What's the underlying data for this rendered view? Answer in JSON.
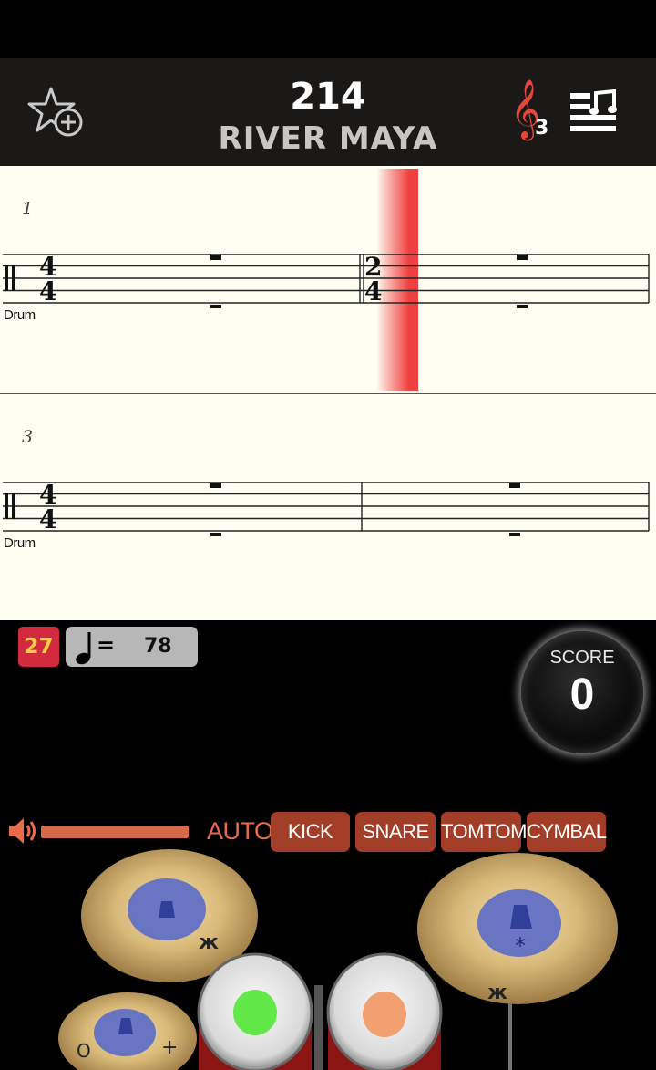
{
  "header": {
    "song_title": "214",
    "artist": "RIVER MAYA",
    "clef_level": "3"
  },
  "score_sheet": {
    "systems": [
      {
        "measure_number": "1",
        "instrument": "Drum",
        "time_signatures": [
          "4/4",
          "2/4"
        ]
      },
      {
        "measure_number": "3",
        "instrument": "Drum",
        "time_signatures": [
          "4/4"
        ]
      }
    ]
  },
  "game": {
    "combo": "27",
    "tempo_symbol": "=",
    "tempo": "78",
    "score_label": "SCORE",
    "score": "0"
  },
  "controls": {
    "auto_label": "AUTO",
    "buttons": [
      "KICK",
      "SNARE",
      "TOMTOM",
      "CYMBAL"
    ]
  },
  "kit": {
    "hihat_left_label": "O",
    "hihat_right_label": "+"
  },
  "colors": {
    "accent": "#e5483a",
    "button": "#a23d27",
    "combo_bg": "#d22a3e",
    "pad_green": "#63e84a",
    "pad_orange": "#f2a070"
  },
  "icons": {
    "favorite": "star-plus-icon",
    "clef": "treble-clef-icon",
    "playlist": "music-list-icon",
    "volume": "speaker-icon",
    "tempo": "quarter-note-icon"
  }
}
